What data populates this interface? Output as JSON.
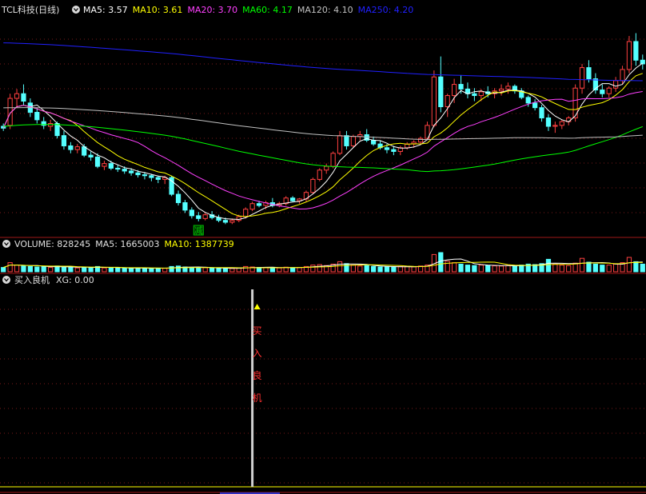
{
  "colors": {
    "background": "#000000",
    "frame": "#a01818",
    "grid": "#7a1a1a",
    "up": "#ff4040",
    "down": "#54ffff",
    "ma5": "#ffffff",
    "ma10": "#ffff00",
    "ma20": "#ff40ff",
    "ma60": "#00ff00",
    "ma120": "#c0c0c0",
    "ma250": "#2020ff",
    "label_white": "#e0e0e0",
    "signal_text": "#ff3030",
    "signal_marker": "#ffff00",
    "reduce_tag": "#00c000"
  },
  "panels": {
    "price": {
      "title": "TCL科技(日线)",
      "legend": [
        {
          "key": "MA5",
          "label": "MA5:",
          "value": "3.57"
        },
        {
          "key": "MA10",
          "label": "MA10:",
          "value": "3.61"
        },
        {
          "key": "MA20",
          "label": "MA20:",
          "value": "3.70"
        },
        {
          "key": "MA60",
          "label": "MA60:",
          "value": "4.17"
        },
        {
          "key": "MA120",
          "label": "MA120:",
          "value": "4.10"
        },
        {
          "key": "MA250",
          "label": "MA250:",
          "value": "4.20"
        }
      ],
      "reduce_tag": "减"
    },
    "volume": {
      "legend": [
        {
          "key": "VOLUME",
          "label": "VOLUME:",
          "value": "828245"
        },
        {
          "key": "MA5",
          "label": "MA5:",
          "value": "1665003"
        },
        {
          "key": "MA10",
          "label": "MA10:",
          "value": "1387739"
        }
      ]
    },
    "indicator": {
      "title": "买入良机",
      "legend": [
        {
          "key": "XG",
          "label": "XG:",
          "value": "0.00"
        }
      ],
      "signal_text": "买入良机",
      "signal_chars": [
        "买",
        "入",
        "良",
        "机"
      ]
    }
  },
  "chart_data": {
    "type": "candlestick",
    "price_range": [
      2.8,
      5.1
    ],
    "grid": true,
    "signal_index": 37,
    "reduce_index": 29,
    "candles": [
      [
        3.95,
        3.98,
        3.9,
        3.93
      ],
      [
        3.96,
        4.3,
        3.92,
        4.25
      ],
      [
        4.25,
        4.35,
        4.15,
        4.3
      ],
      [
        4.3,
        4.4,
        4.18,
        4.22
      ],
      [
        4.2,
        4.25,
        4.05,
        4.1
      ],
      [
        4.1,
        4.15,
        3.98,
        4.02
      ],
      [
        4.0,
        4.05,
        3.92,
        3.96
      ],
      [
        3.95,
        4.02,
        3.9,
        3.98
      ],
      [
        3.98,
        4.0,
        3.82,
        3.85
      ],
      [
        3.85,
        3.9,
        3.7,
        3.74
      ],
      [
        3.74,
        3.78,
        3.66,
        3.7
      ],
      [
        3.7,
        3.76,
        3.66,
        3.73
      ],
      [
        3.73,
        3.76,
        3.62,
        3.64
      ],
      [
        3.64,
        3.68,
        3.58,
        3.62
      ],
      [
        3.62,
        3.66,
        3.5,
        3.52
      ],
      [
        3.52,
        3.58,
        3.48,
        3.55
      ],
      [
        3.55,
        3.58,
        3.48,
        3.5
      ],
      [
        3.5,
        3.54,
        3.46,
        3.49
      ],
      [
        3.49,
        3.52,
        3.44,
        3.47
      ],
      [
        3.47,
        3.5,
        3.42,
        3.45
      ],
      [
        3.45,
        3.48,
        3.4,
        3.43
      ],
      [
        3.43,
        3.46,
        3.38,
        3.42
      ],
      [
        3.42,
        3.44,
        3.36,
        3.4
      ],
      [
        3.4,
        3.42,
        3.34,
        3.38
      ],
      [
        3.38,
        3.42,
        3.33,
        3.4
      ],
      [
        3.4,
        3.42,
        3.2,
        3.22
      ],
      [
        3.22,
        3.26,
        3.1,
        3.13
      ],
      [
        3.13,
        3.16,
        3.02,
        3.05
      ],
      [
        3.05,
        3.08,
        2.96,
        2.99
      ],
      [
        2.99,
        3.03,
        2.93,
        2.96
      ],
      [
        2.96,
        3.02,
        2.94,
        3.0
      ],
      [
        3.0,
        3.04,
        2.95,
        2.97
      ],
      [
        2.97,
        3.0,
        2.92,
        2.94
      ],
      [
        2.94,
        2.97,
        2.9,
        2.92
      ],
      [
        2.92,
        2.96,
        2.9,
        2.94
      ],
      [
        2.94,
        3.0,
        2.92,
        2.98
      ],
      [
        2.98,
        3.08,
        2.96,
        3.06
      ],
      [
        3.06,
        3.14,
        3.04,
        3.12
      ],
      [
        3.12,
        3.15,
        3.08,
        3.1
      ],
      [
        3.1,
        3.15,
        3.06,
        3.13
      ],
      [
        3.13,
        3.18,
        3.08,
        3.1
      ],
      [
        3.1,
        3.14,
        3.08,
        3.12
      ],
      [
        3.12,
        3.2,
        3.1,
        3.18
      ],
      [
        3.18,
        3.2,
        3.14,
        3.15
      ],
      [
        3.15,
        3.18,
        3.12,
        3.17
      ],
      [
        3.17,
        3.26,
        3.14,
        3.24
      ],
      [
        3.24,
        3.4,
        3.22,
        3.38
      ],
      [
        3.38,
        3.5,
        3.36,
        3.48
      ],
      [
        3.48,
        3.55,
        3.44,
        3.52
      ],
      [
        3.52,
        3.68,
        3.5,
        3.66
      ],
      [
        3.66,
        3.9,
        3.64,
        3.85
      ],
      [
        3.85,
        3.9,
        3.7,
        3.74
      ],
      [
        3.74,
        3.86,
        3.72,
        3.84
      ],
      [
        3.84,
        3.9,
        3.8,
        3.86
      ],
      [
        3.86,
        3.92,
        3.78,
        3.8
      ],
      [
        3.8,
        3.84,
        3.74,
        3.76
      ],
      [
        3.76,
        3.8,
        3.7,
        3.72
      ],
      [
        3.72,
        3.76,
        3.66,
        3.7
      ],
      [
        3.7,
        3.74,
        3.64,
        3.68
      ],
      [
        3.68,
        3.74,
        3.64,
        3.72
      ],
      [
        3.72,
        3.78,
        3.7,
        3.76
      ],
      [
        3.76,
        3.8,
        3.72,
        3.78
      ],
      [
        3.78,
        3.84,
        3.76,
        3.82
      ],
      [
        3.82,
        4.0,
        3.8,
        3.96
      ],
      [
        3.96,
        4.55,
        3.94,
        4.48
      ],
      [
        4.48,
        4.7,
        4.1,
        4.16
      ],
      [
        4.16,
        4.3,
        4.05,
        4.28
      ],
      [
        4.28,
        4.46,
        4.2,
        4.4
      ],
      [
        4.4,
        4.5,
        4.3,
        4.35
      ],
      [
        4.35,
        4.42,
        4.25,
        4.3
      ],
      [
        4.3,
        4.36,
        4.22,
        4.28
      ],
      [
        4.28,
        4.35,
        4.22,
        4.32
      ],
      [
        4.32,
        4.38,
        4.26,
        4.3
      ],
      [
        4.3,
        4.36,
        4.25,
        4.33
      ],
      [
        4.33,
        4.4,
        4.28,
        4.35
      ],
      [
        4.35,
        4.42,
        4.3,
        4.38
      ],
      [
        4.38,
        4.4,
        4.3,
        4.33
      ],
      [
        4.33,
        4.36,
        4.24,
        4.26
      ],
      [
        4.26,
        4.28,
        4.16,
        4.2
      ],
      [
        4.2,
        4.24,
        4.12,
        4.15
      ],
      [
        4.15,
        4.18,
        4.0,
        4.04
      ],
      [
        4.04,
        4.08,
        3.9,
        3.95
      ],
      [
        3.95,
        4.0,
        3.88,
        3.96
      ],
      [
        3.96,
        4.02,
        3.92,
        4.0
      ],
      [
        4.0,
        4.06,
        3.96,
        4.04
      ],
      [
        4.04,
        4.4,
        4.0,
        4.36
      ],
      [
        4.36,
        4.62,
        4.3,
        4.58
      ],
      [
        4.58,
        4.66,
        4.42,
        4.46
      ],
      [
        4.46,
        4.52,
        4.3,
        4.34
      ],
      [
        4.34,
        4.4,
        4.26,
        4.3
      ],
      [
        4.3,
        4.38,
        4.26,
        4.36
      ],
      [
        4.36,
        4.48,
        4.32,
        4.44
      ],
      [
        4.44,
        4.6,
        4.4,
        4.56
      ],
      [
        4.56,
        4.92,
        4.52,
        4.86
      ],
      [
        4.86,
        4.95,
        4.6,
        4.66
      ],
      [
        4.66,
        4.72,
        4.56,
        4.62
      ]
    ],
    "volumes": [
      0.45,
      0.95,
      0.7,
      0.6,
      0.55,
      0.5,
      0.55,
      0.45,
      0.6,
      0.5,
      0.45,
      0.4,
      0.5,
      0.45,
      0.55,
      0.4,
      0.4,
      0.38,
      0.4,
      0.35,
      0.38,
      0.4,
      0.35,
      0.38,
      0.36,
      0.55,
      0.6,
      0.5,
      0.45,
      0.4,
      0.42,
      0.38,
      0.35,
      0.36,
      0.34,
      0.4,
      0.55,
      0.5,
      0.45,
      0.42,
      0.45,
      0.4,
      0.48,
      0.42,
      0.44,
      0.55,
      0.7,
      0.75,
      0.65,
      0.8,
      1.05,
      0.85,
      0.7,
      0.6,
      0.65,
      0.55,
      0.5,
      0.52,
      0.48,
      0.55,
      0.55,
      0.52,
      0.6,
      0.7,
      1.8,
      2.0,
      1.1,
      0.95,
      0.8,
      0.7,
      0.65,
      0.7,
      0.65,
      0.62,
      0.6,
      0.65,
      0.6,
      0.7,
      0.8,
      0.75,
      0.85,
      1.3,
      0.8,
      0.7,
      0.65,
      0.9,
      1.4,
      1.0,
      0.8,
      0.7,
      0.7,
      0.8,
      0.95,
      1.5,
      1.05,
      0.8
    ]
  }
}
